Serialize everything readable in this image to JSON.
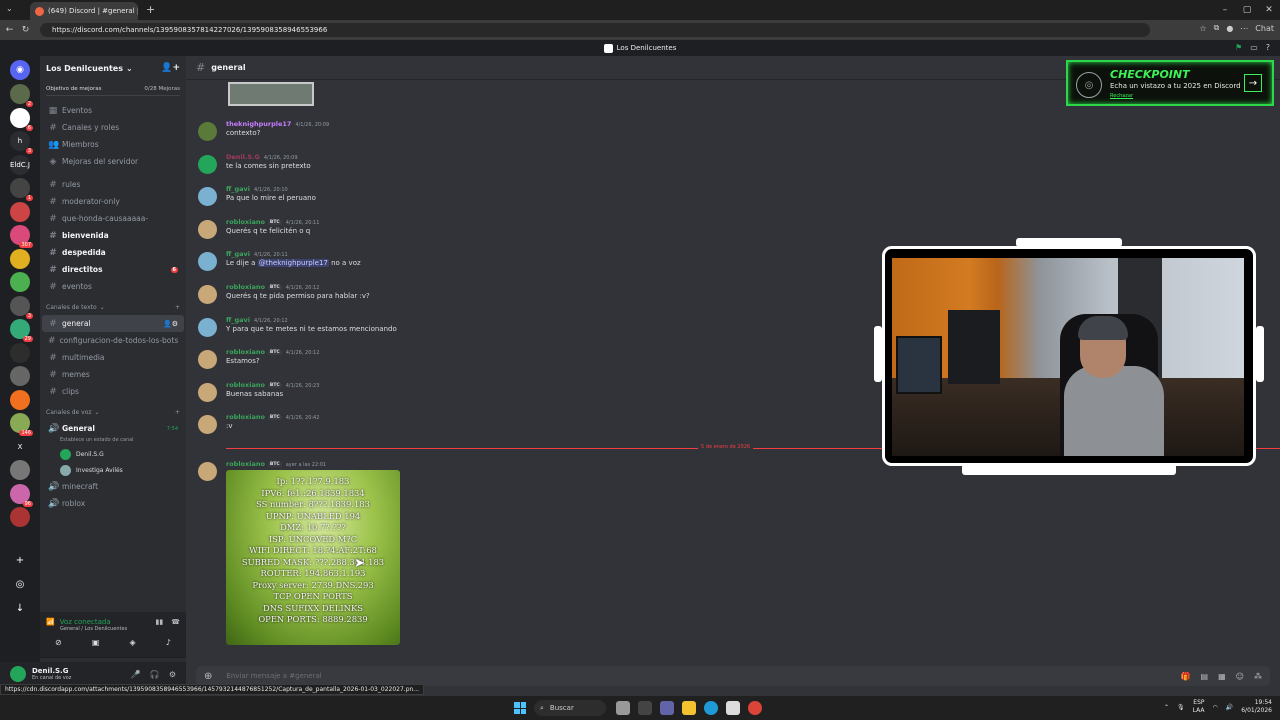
{
  "browser": {
    "tab_title": "(649) Discord | #general | Los",
    "url": "https://discord.com/channels/1395908357814227026/1395908358946553966",
    "chat_label": "Chat",
    "status_url": "https://cdn.discordapp.com/attachments/1395908358946553966/1457932144876851252/Captura_de_pantalla_2026-01-03_022027.pn..."
  },
  "discord_title": "Los Denilcuentes",
  "guilds": [
    {
      "badge": "2",
      "color": "#5a6a4a"
    },
    {
      "badge": "6",
      "color": "#ffffff"
    },
    {
      "label": "h",
      "badge": "3",
      "color": "#2b2d31"
    },
    {
      "label": "EldC.J",
      "color": "#2b2d31"
    },
    {
      "badge": "1",
      "color": "#444"
    },
    {
      "badge": "",
      "color": "#c44"
    },
    {
      "badge": "307",
      "color": "#d94a7a"
    },
    {
      "badge": "",
      "color": "#e0b020"
    },
    {
      "badge": "",
      "color": "#4caf50"
    },
    {
      "badge": "3",
      "color": "#555"
    },
    {
      "badge": "29",
      "color": "#3a7"
    },
    {
      "badge": "",
      "color": "#2d2d2d"
    },
    {
      "badge": "",
      "color": "#666"
    },
    {
      "badge": "",
      "color": "#f07020"
    },
    {
      "badge": "146",
      "color": "#8a5"
    },
    {
      "label": "X",
      "color": "#1e1f22"
    },
    {
      "badge": "",
      "color": "#777"
    },
    {
      "badge": "96",
      "color": "#c6a"
    },
    {
      "badge": "",
      "color": "#a33"
    }
  ],
  "server": {
    "name": "Los Denilcuentes",
    "boost_label": "Objetivo de mejoras",
    "boost_count": "0/28 Mejoras",
    "nav": [
      "Eventos",
      "Canales y roles",
      "Miembros",
      "Mejoras del servidor"
    ],
    "channels_top": [
      {
        "name": "rules",
        "unread": false
      },
      {
        "name": "moderator-only",
        "unread": false
      },
      {
        "name": "que-honda-causaaaaa-",
        "unread": false
      },
      {
        "name": "bienvenida",
        "unread": true
      },
      {
        "name": "despedida",
        "unread": true
      },
      {
        "name": "directitos",
        "unread": true,
        "badge": "6"
      },
      {
        "name": "eventos",
        "unread": false
      }
    ],
    "text_category": "Canales de texto",
    "text_channels": [
      {
        "name": "general",
        "selected": true
      },
      {
        "name": "configuracion-de-todos-los-bots"
      },
      {
        "name": "multimedia"
      },
      {
        "name": "memes"
      },
      {
        "name": "clips"
      }
    ],
    "voice_category": "Canales de voz",
    "voice_channel": {
      "name": "General",
      "time": "7:54",
      "status": "Establece un estado de canal"
    },
    "voice_users": [
      {
        "name": "Denil.S.G",
        "color": "#23a55a"
      },
      {
        "name": "Investiga Avilés",
        "color": "#8aa"
      }
    ],
    "voice_channels_more": [
      "minecraft",
      "roblox"
    ]
  },
  "voice_panel": {
    "title": "Voz conectada",
    "sub": "General / Los Denilcuentes"
  },
  "user_panel": {
    "name": "Denil.S.G",
    "status": "En canal de voz"
  },
  "channel_header": "general",
  "messages": [
    {
      "author": "theknighpurple17",
      "color": "#c77dff",
      "tag": "",
      "ts": "4/1/26, 20:09",
      "text": "contexto?",
      "av": "#5a7a3a"
    },
    {
      "author": "Denil.S.G",
      "color": "#a23b5a",
      "tag": "",
      "ts": "4/1/26, 20:09",
      "text": "te la comes sin pretexto",
      "av": "#23a55a"
    },
    {
      "author": "ff_gavi",
      "color": "#3ba55c",
      "tag": "",
      "ts": "4/1/26, 20:10",
      "text": "Pa que lo mire el peruano",
      "av": "#7ab0d0"
    },
    {
      "author": "robloxiano",
      "color": "#3ba55c",
      "tag": "BTC",
      "ts": "4/1/26, 20:11",
      "text": "Querés q te felicitén o q",
      "av": "#c8a878"
    },
    {
      "author": "ff_gavi",
      "color": "#3ba55c",
      "tag": "",
      "ts": "4/1/26, 20:11",
      "text_pre": "Le dije a ",
      "mention": "@theknighpurple17",
      "text_post": " no a voz",
      "av": "#7ab0d0"
    },
    {
      "author": "robloxiano",
      "color": "#3ba55c",
      "tag": "BTC",
      "ts": "4/1/26, 20:12",
      "text": "Querés q te pida permiso para hablar :v?",
      "av": "#c8a878"
    },
    {
      "author": "ff_gavi",
      "color": "#3ba55c",
      "tag": "",
      "ts": "4/1/26, 20:12",
      "text": "Y para que te metes ni te estamos mencionando",
      "av": "#7ab0d0"
    },
    {
      "author": "robloxiano",
      "color": "#3ba55c",
      "tag": "BTC",
      "ts": "4/1/26, 20:12",
      "text": "Estamos?",
      "av": "#c8a878"
    },
    {
      "author": "robloxiano",
      "color": "#3ba55c",
      "tag": "BTC",
      "ts": "4/1/26, 20:23",
      "text": "Buenas sabanas",
      "av": "#c8a878"
    },
    {
      "author": "robloxiano",
      "color": "#3ba55c",
      "tag": "BTC",
      "ts": "4/1/26, 20:42",
      "text": ":v",
      "av": "#c8a878"
    }
  ],
  "date_divider": "5 de enero de 2026",
  "last_message": {
    "author": "robloxiano",
    "tag": "BTC",
    "ts": "ayer a las 22:01"
  },
  "attachment_lines": [
    "Ip: 1??.1?7.9.183",
    "IPV6: fe1::26.1839.1834",
    "SS number: 8???.1839.183",
    "UPNP: UNABLED 194",
    "DMZ: 10.7?.???",
    "ISP: UNCOVED M?C",
    "WIFI DIRECT: 18.?4:AF:2T:68",
    "SUBRED MASK: ???.288.364.183",
    "ROUTER: 194.863.1.193",
    "Proxy server: 2739.DNS.293",
    "TCP OPEN PORTS",
    "DNS SUFIXX DELINKS",
    "OPEN PORTS: 8889.2839"
  ],
  "composer_placeholder": "Enviar mensaje a #general",
  "checkpoint": {
    "title": "CHECKPOINT",
    "text": "Echa un vistazo a tu 2025 en Discord",
    "dismiss": "Rechazar"
  },
  "taskbar": {
    "search": "Buscar",
    "lang": "ESP",
    "lang2": "LAA",
    "time": "19:54",
    "date": "6/01/2026"
  }
}
